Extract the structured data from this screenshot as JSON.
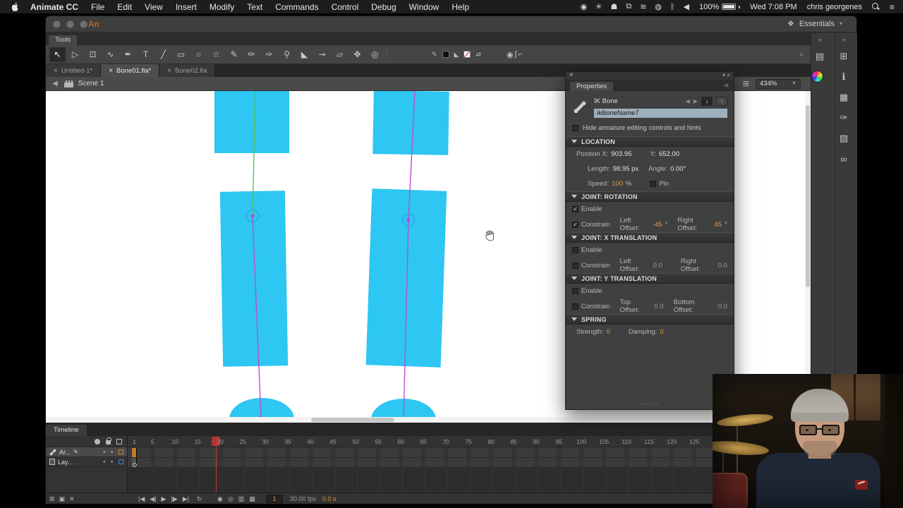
{
  "menubar": {
    "app_name": "Animate CC",
    "items": [
      "File",
      "Edit",
      "View",
      "Insert",
      "Modify",
      "Text",
      "Commands",
      "Control",
      "Debug",
      "Window",
      "Help"
    ],
    "status_icons": [
      {
        "name": "screen-record-icon",
        "glyph": "◉"
      },
      {
        "name": "flower-icon",
        "glyph": "✳"
      },
      {
        "name": "app-status-icon",
        "glyph": "☗"
      },
      {
        "name": "display-icon",
        "glyph": "⧉"
      },
      {
        "name": "wifi-icon",
        "glyph": "≋"
      },
      {
        "name": "sync-icon",
        "glyph": "◍"
      },
      {
        "name": "bluetooth-icon",
        "glyph": "ᛒ"
      },
      {
        "name": "volume-icon",
        "glyph": "◀"
      }
    ],
    "battery": "100%",
    "clock": "Wed 7:08 PM",
    "user": "chris georgenes"
  },
  "window": {
    "title": "An",
    "workspace": "Essentials",
    "tools_tab": "Tools"
  },
  "toolbar": {
    "tools": [
      {
        "name": "selection-tool",
        "glyph": "↖",
        "selected": true
      },
      {
        "name": "subselection-tool",
        "glyph": "▷"
      },
      {
        "name": "free-transform-tool",
        "glyph": "⊡"
      },
      {
        "name": "lasso-tool",
        "glyph": "∿"
      },
      {
        "name": "pen-tool",
        "glyph": "✒"
      },
      {
        "name": "text-tool",
        "glyph": "T"
      },
      {
        "name": "line-tool",
        "glyph": "╱"
      },
      {
        "name": "rectangle-tool",
        "glyph": "▭"
      },
      {
        "name": "oval-tool",
        "glyph": "○"
      },
      {
        "name": "polystar-tool",
        "glyph": "☆"
      },
      {
        "name": "pencil-tool",
        "glyph": "✎"
      },
      {
        "name": "brush-tool",
        "glyph": "✏"
      },
      {
        "name": "paint-brush-tool",
        "glyph": "✑"
      },
      {
        "name": "bone-tool",
        "glyph": "⚲"
      },
      {
        "name": "paint-bucket-tool",
        "glyph": "◣"
      },
      {
        "name": "eyedropper-tool",
        "glyph": "⊸"
      },
      {
        "name": "eraser-tool",
        "glyph": "▱"
      },
      {
        "name": "hand-tool",
        "glyph": "✥"
      },
      {
        "name": "zoom-tool",
        "glyph": "◎"
      }
    ],
    "extras": [
      {
        "name": "camera-button",
        "glyph": "◉"
      },
      {
        "name": "motion-curve-button",
        "glyph": "∫"
      },
      {
        "name": "corner-button",
        "glyph": "⌐"
      }
    ],
    "collapse_glyph": "«"
  },
  "doc_tabs": [
    {
      "label": "Untitled-1*",
      "active": false
    },
    {
      "label": "Bone01.fla*",
      "active": true
    },
    {
      "label": "Bone02.fla",
      "active": false
    }
  ],
  "edit_bar": {
    "scene": "Scene 1",
    "zoom": "434%"
  },
  "right_rail": {
    "col_a": [
      {
        "name": "collapse-panels-icon",
        "glyph": "«"
      },
      {
        "name": "library-panel-icon",
        "glyph": "▤"
      },
      {
        "name": "color-panel-icon",
        "glyph": "wheel"
      }
    ],
    "col_b": [
      {
        "name": "collapse-panels-icon",
        "glyph": "«"
      },
      {
        "name": "align-panel-icon",
        "glyph": "⊞"
      },
      {
        "name": "info-panel-icon",
        "glyph": "ℹ"
      },
      {
        "name": "swatches-panel-icon",
        "glyph": "▦"
      },
      {
        "name": "brush-library-panel-icon",
        "glyph": "✑"
      },
      {
        "name": "components-panel-icon",
        "glyph": "▧"
      },
      {
        "name": "code-snippets-panel-icon",
        "glyph": "∞"
      }
    ]
  },
  "stage_colors": {
    "shape_cyan": "#2ec6f2",
    "bone_green": "#56c353",
    "bone_purple": "#b94fd1",
    "joint_blue": "#2ba8e8",
    "joint_magenta": "#d23bd2"
  },
  "properties": {
    "tab": "Properties",
    "object_type": "IK Bone",
    "name_value": "ikBoneName7",
    "hide_label": "Hide armature editing controls and hints",
    "location": {
      "title": "LOCATION",
      "pos_label": "Position X:",
      "pos_x": "903.95",
      "y_label": "Y:",
      "pos_y": "652.00",
      "length_label": "Length:",
      "length": "98.95 px",
      "angle_label": "Angle:",
      "angle": "0.00°",
      "speed_label": "Speed:",
      "speed": "100",
      "speed_unit": "%",
      "pin_label": "Pin"
    },
    "rotation": {
      "title": "JOINT: ROTATION",
      "enable": "Enable",
      "constrain": "Constrain",
      "left_label": "Left Offset:",
      "left": "-45",
      "deg": "°",
      "right_label": "Right Offset:",
      "right": "45"
    },
    "xtrans": {
      "title": "JOINT: X TRANSLATION",
      "enable": "Enable",
      "constrain": "Constrain",
      "left_label": "Left Offset:",
      "left": "0.0",
      "right_label": "Right Offset:",
      "right": "0.0"
    },
    "ytrans": {
      "title": "JOINT: Y TRANSLATION",
      "enable": "Enable",
      "constrain": "Constrain",
      "top_label": "Top Offset:",
      "top": "0.0",
      "bottom_label": "Bottom Offset:",
      "bottom": "0.0"
    },
    "spring": {
      "title": "SPRING",
      "strength_label": "Strength:",
      "strength": "0",
      "damping_label": "Damping:",
      "damping": "0"
    },
    "checks": {
      "hide": "",
      "pin": "",
      "rot_enable": "✓",
      "rot_constrain": "✓",
      "x_enable": "",
      "x_constrain": "",
      "y_enable": "",
      "y_constrain": ""
    }
  },
  "timeline": {
    "tab": "Timeline",
    "layers": [
      {
        "name": "Ar..."
      },
      {
        "name": "Lay..."
      }
    ],
    "frame_numbers": [
      "1",
      "5",
      "10",
      "15",
      "20",
      "25",
      "30",
      "35",
      "40",
      "45",
      "50",
      "55",
      "60",
      "65",
      "70",
      "75",
      "80",
      "85",
      "90",
      "95",
      "100",
      "105",
      "110",
      "115",
      "120",
      "125"
    ],
    "layers_controls": [
      {
        "name": "new-layer-button",
        "glyph": "⊞"
      },
      {
        "name": "new-folder-button",
        "glyph": "▣"
      },
      {
        "name": "delete-layer-button",
        "glyph": "✕"
      }
    ],
    "playback_controls": [
      {
        "name": "go-to-first-frame-button",
        "glyph": "|◀"
      },
      {
        "name": "step-back-button",
        "glyph": "◀|"
      },
      {
        "name": "play-button",
        "glyph": "▶"
      },
      {
        "name": "step-forward-button",
        "glyph": "|▶"
      },
      {
        "name": "go-to-last-frame-button",
        "glyph": "▶|"
      }
    ],
    "loop_controls": [
      {
        "name": "loop-button",
        "glyph": "↻"
      }
    ],
    "onion_controls": [
      {
        "name": "onion-skin-button",
        "glyph": "◉"
      },
      {
        "name": "onion-skin-outlines-button",
        "glyph": "◎"
      },
      {
        "name": "edit-multiple-frames-button",
        "glyph": "▥"
      },
      {
        "name": "modify-markers-button",
        "glyph": "▦"
      }
    ],
    "current_frame": "1",
    "fps": "30.00 fps",
    "elapsed": "0.0 s"
  },
  "colors": {
    "accent_orange": "#e09c40",
    "playhead_red": "#b13530",
    "layer1_swatch": "#cf7f2e",
    "layer2_swatch": "#4a7fd4"
  }
}
